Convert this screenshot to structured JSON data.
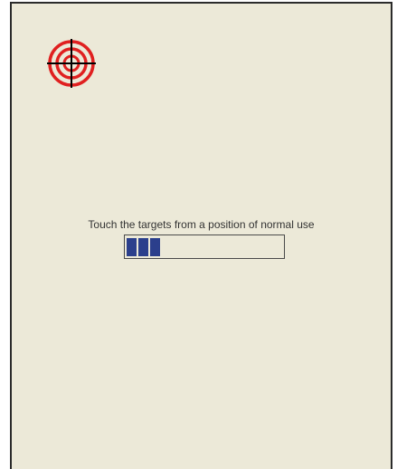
{
  "calibration": {
    "instruction": "Touch the targets from a position of normal use",
    "progress": {
      "filled_blocks": 3
    },
    "target_icon": "crosshair-target-icon"
  },
  "colors": {
    "background": "#ece9d8",
    "border": "#2b2b2b",
    "target_red": "#e02020",
    "crosshair": "#000000",
    "progress_fill": "#2b3f8c"
  }
}
